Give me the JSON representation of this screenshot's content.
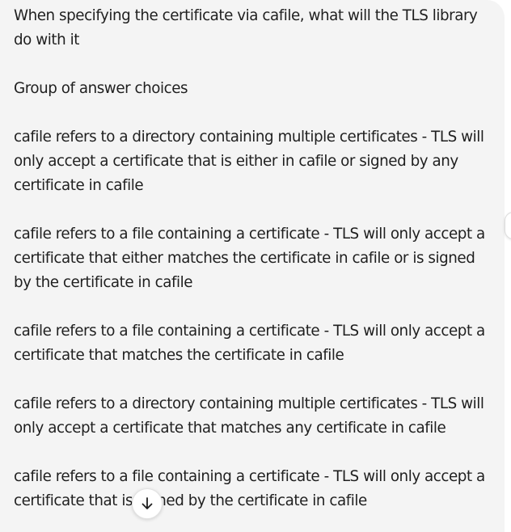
{
  "message": {
    "question": "When specifying the certificate via cafile, what will the TLS library do with it",
    "group_label": "Group of answer choices",
    "choices": [
      "cafile refers to a directory containing multiple certificates - TLS will only accept a certificate that is either in cafile or signed by any certificate in cafile",
      "cafile refers to a file containing a certificate - TLS will only accept a certificate that either matches the certificate in cafile or is signed by the certificate in cafile",
      "cafile refers to a file containing a certificate - TLS will only accept a certificate that matches the certificate in cafile",
      "cafile refers to a directory containing multiple certificates - TLS will only accept a certificate that matches any certificate in cafile",
      "cafile refers to a file containing a certificate - TLS will only accept a certificate that is signed by the certificate in cafile"
    ]
  },
  "controls": {
    "scroll_down_icon": "arrow-down-icon"
  },
  "colors": {
    "bubble_background": "#f4f4f4",
    "text": "#1f1f1f",
    "page_background": "#ffffff"
  }
}
